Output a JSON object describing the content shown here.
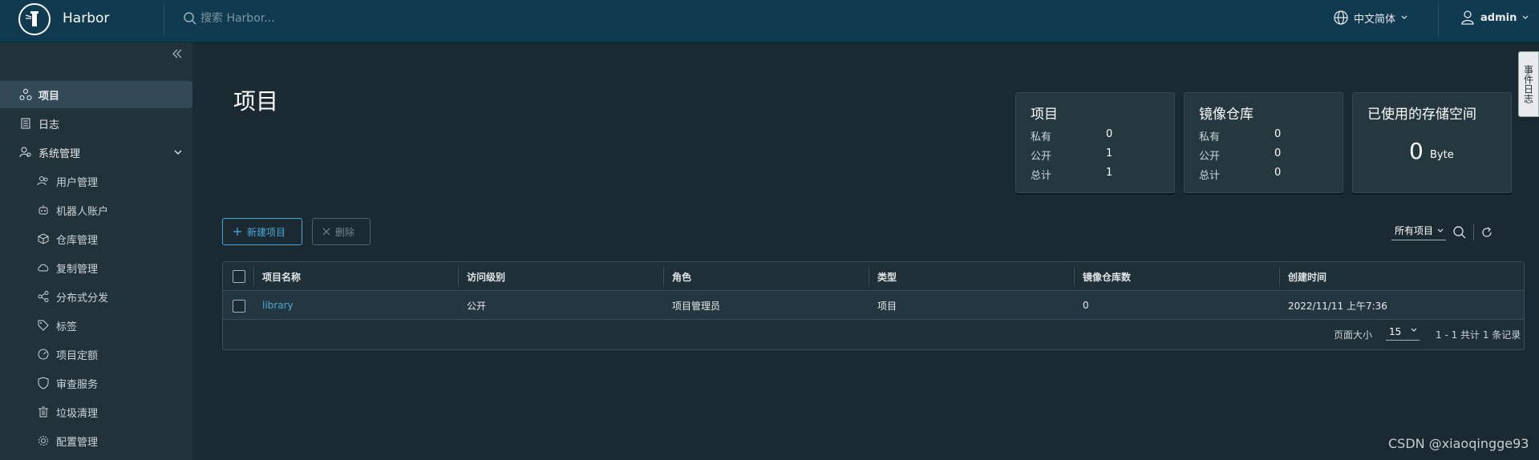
{
  "header": {
    "brand": "Harbor",
    "search_placeholder": "搜索 Harbor...",
    "language": "中文简体",
    "user": "admin"
  },
  "sidebar": {
    "items": [
      {
        "label": "项目",
        "icon": "projects-icon"
      },
      {
        "label": "日志",
        "icon": "logs-icon"
      },
      {
        "label": "系统管理",
        "icon": "admin-icon"
      },
      {
        "label": "用户管理",
        "icon": "users-icon"
      },
      {
        "label": "机器人账户",
        "icon": "robot-icon"
      },
      {
        "label": "仓库管理",
        "icon": "registry-icon"
      },
      {
        "label": "复制管理",
        "icon": "replication-icon"
      },
      {
        "label": "分布式分发",
        "icon": "distribution-icon"
      },
      {
        "label": "标签",
        "icon": "tag-icon"
      },
      {
        "label": "项目定额",
        "icon": "quota-icon"
      },
      {
        "label": "审查服务",
        "icon": "shield-icon"
      },
      {
        "label": "垃圾清理",
        "icon": "trash-icon"
      },
      {
        "label": "配置管理",
        "icon": "gear-icon"
      }
    ]
  },
  "page": {
    "title": "项目"
  },
  "cards": {
    "projects": {
      "title": "项目",
      "rows": [
        {
          "label": "私有",
          "value": "0"
        },
        {
          "label": "公开",
          "value": "1"
        },
        {
          "label": "总计",
          "value": "1"
        }
      ]
    },
    "repos": {
      "title": "镜像仓库",
      "rows": [
        {
          "label": "私有",
          "value": "0"
        },
        {
          "label": "公开",
          "value": "0"
        },
        {
          "label": "总计",
          "value": "0"
        }
      ]
    },
    "storage": {
      "title": "已使用的存储空间",
      "value": "0",
      "unit": "Byte"
    }
  },
  "toolbar": {
    "new_project": "新建项目",
    "delete": "删除",
    "filter": "所有项目"
  },
  "table": {
    "headers": [
      "项目名称",
      "访问级别",
      "角色",
      "类型",
      "镜像仓库数",
      "创建时间"
    ],
    "rows": [
      {
        "name": "library",
        "access": "公开",
        "role": "项目管理员",
        "type": "项目",
        "repo_count": "0",
        "created": "2022/11/11 上午7:36"
      }
    ],
    "page_size_label": "页面大小",
    "page_size": "15",
    "summary": "1 - 1 共计 1 条记录"
  },
  "side_tab": "事件日志",
  "watermark": "CSDN @xiaoqingge93"
}
